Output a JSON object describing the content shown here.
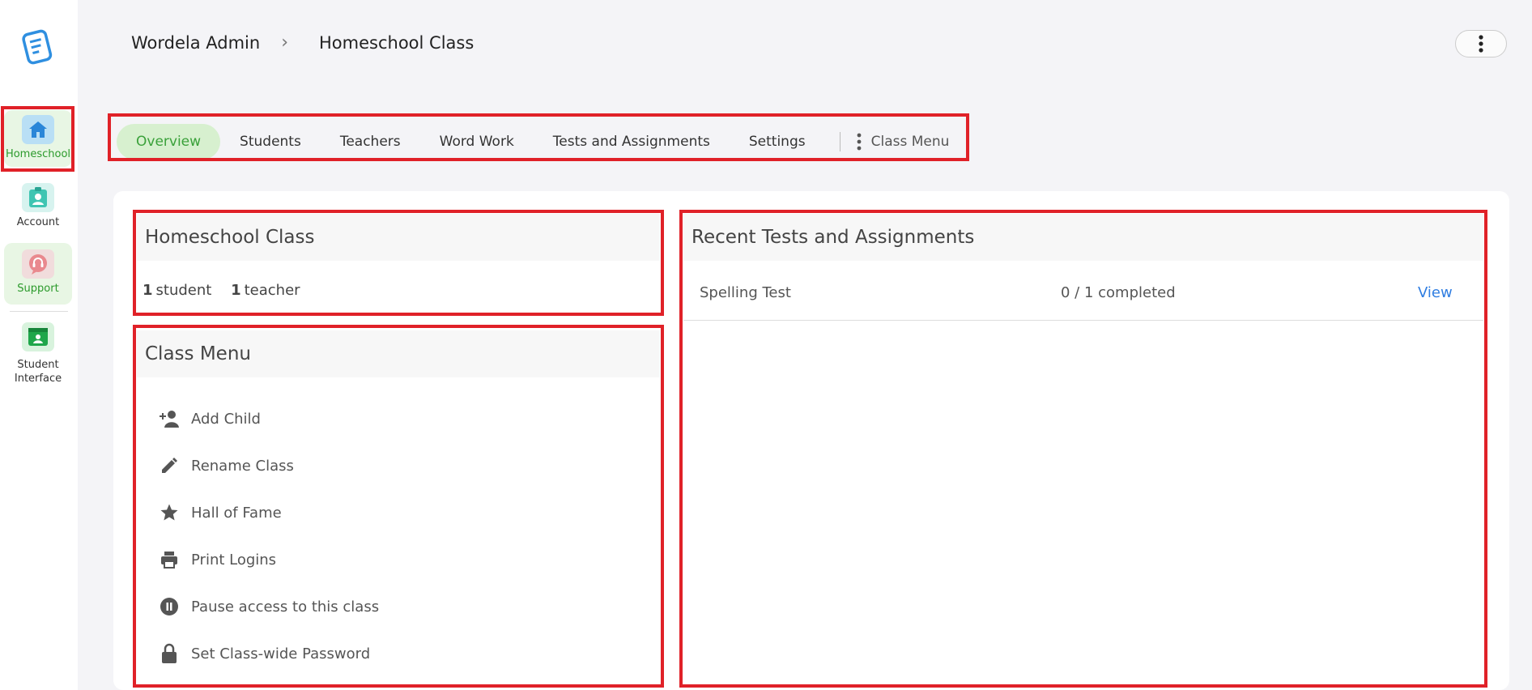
{
  "sidebar": {
    "items": [
      {
        "label": "Homeschool",
        "icon": "home-icon"
      },
      {
        "label": "Account",
        "icon": "id-badge-icon"
      },
      {
        "label": "Support",
        "icon": "support-chat-icon"
      },
      {
        "label": "Student\nInterface",
        "icon": "student-window-icon"
      }
    ]
  },
  "header": {
    "breadcrumb": [
      "Wordela Admin",
      "Homeschool Class"
    ]
  },
  "tabs": [
    {
      "label": "Overview",
      "active": true
    },
    {
      "label": "Students"
    },
    {
      "label": "Teachers"
    },
    {
      "label": "Word Work"
    },
    {
      "label": "Tests and Assignments"
    },
    {
      "label": "Settings"
    }
  ],
  "tab_menu_label": "Class Menu",
  "class_card": {
    "title": "Homeschool Class",
    "student_count": "1",
    "student_label": "student",
    "teacher_count": "1",
    "teacher_label": "teacher"
  },
  "class_menu": {
    "title": "Class Menu",
    "items": [
      {
        "label": "Add Child",
        "icon": "add-person-icon"
      },
      {
        "label": "Rename Class",
        "icon": "pencil-icon"
      },
      {
        "label": "Hall of Fame",
        "icon": "star-icon"
      },
      {
        "label": "Print Logins",
        "icon": "printer-icon"
      },
      {
        "label": "Pause access to this class",
        "icon": "pause-icon"
      },
      {
        "label": "Set Class-wide Password",
        "icon": "lock-icon"
      }
    ]
  },
  "recent": {
    "title": "Recent Tests and Assignments",
    "rows": [
      {
        "name": "Spelling Test",
        "status": "0 / 1 completed",
        "action": "View"
      }
    ]
  },
  "colors": {
    "accent_green": "#3aa13a",
    "link_blue": "#2f7de1",
    "highlight_red": "#e02128"
  }
}
